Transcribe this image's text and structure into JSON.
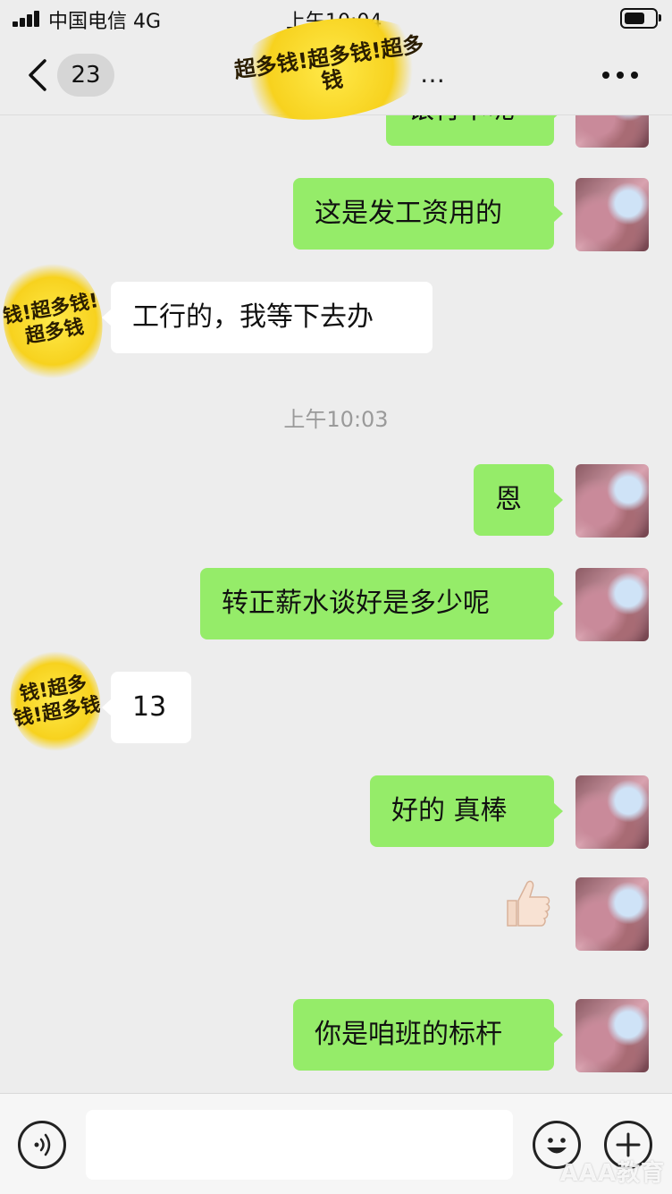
{
  "status_bar": {
    "carrier": "中国电信 4G",
    "time": "上午10:04",
    "battery_level": 0.7,
    "signal_bars": 4
  },
  "nav": {
    "unread_count": "23",
    "title": "…",
    "title_mask_text": "超多钱!超多钱!超多钱"
  },
  "messages": [
    {
      "side": "me",
      "text": "银行卡呢"
    },
    {
      "side": "me",
      "text": "这是发工资用的"
    },
    {
      "side": "them",
      "text": "工行的，我等下去办"
    },
    {
      "time": "上午10:03"
    },
    {
      "side": "me",
      "text": "恩"
    },
    {
      "side": "me",
      "text": "转正薪水谈好是多少呢"
    },
    {
      "side": "them",
      "text": "13"
    },
    {
      "side": "me",
      "text": "好的  真棒"
    },
    {
      "side": "me",
      "sticker": "thumbs-up"
    },
    {
      "side": "me",
      "text": "你是咱班的标杆"
    }
  ],
  "avatar_mask_text": "钱!超多钱!超多钱",
  "input": {
    "placeholder": ""
  },
  "watermark": "AAA教育",
  "colors": {
    "my_bubble": "#95ec69",
    "their_bubble": "#ffffff",
    "background": "#ededed",
    "mask": "#f7d21e"
  }
}
